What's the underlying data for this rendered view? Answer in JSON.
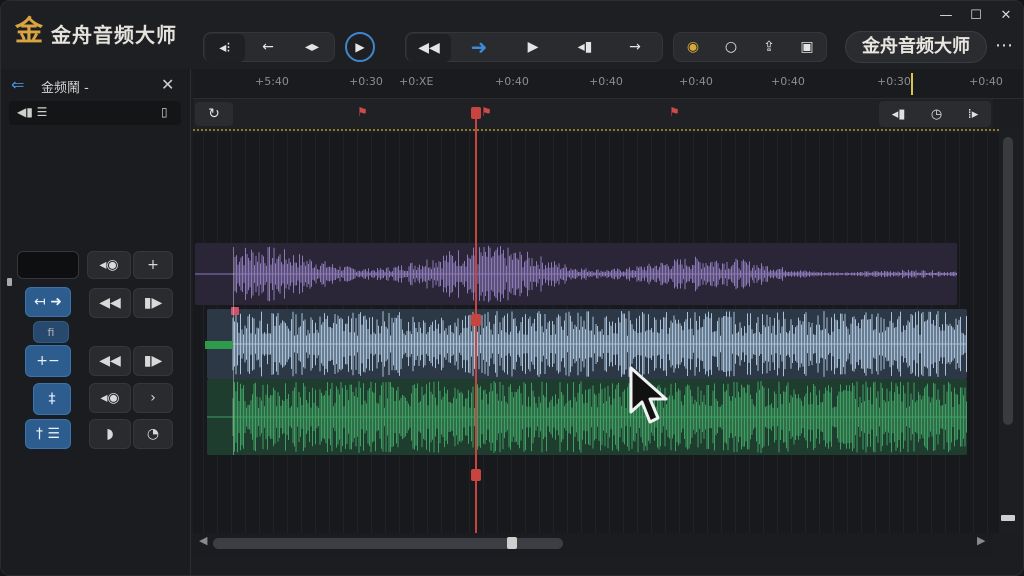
{
  "app": {
    "logo_char": "金",
    "title": "金舟音频大师",
    "title_pill": "金舟音频大师",
    "window_controls": {
      "minimize": "—",
      "maximize": "☐",
      "close": "✕"
    },
    "more": "⋯"
  },
  "toolbar": {
    "group1": [
      "◂⁝",
      "←",
      "◂▸"
    ],
    "play": "▶",
    "group2": [
      "◀◀",
      "➜",
      "▶",
      "◂▮",
      "→"
    ],
    "group3": [
      "◉",
      "○",
      "⇪",
      "▣"
    ]
  },
  "panel": {
    "back_icon": "⇐",
    "title": "金频鬧 -",
    "close": "✕",
    "mini_left": "◀▮ ☰",
    "mini_right": "▯",
    "controls": [
      [
        "",
        "◂◉",
        "+"
      ],
      [
        "↤ ➜",
        "◀◀",
        "▮▶"
      ],
      [
        "fi"
      ],
      [
        "+−",
        "◀◀",
        "▮▶"
      ],
      [
        "‡",
        "◂◉",
        "›"
      ],
      [
        "† ☰",
        "◗",
        "◔"
      ]
    ]
  },
  "ruler": {
    "ticks": [
      "+5:40",
      "+0:30",
      "+0:XE",
      "+0:40",
      "+0:40",
      "+0:40",
      "+0:40",
      "+0:30",
      "+0:40"
    ]
  },
  "marker_bar": {
    "loop": "↻",
    "tools": [
      "◂▮",
      "◷",
      "⁞▸"
    ]
  },
  "tracks": [
    {
      "name": "purple-track",
      "color": "#8c79b8",
      "bg": "#2a2638"
    },
    {
      "name": "blue-track",
      "color": "#a8c0d8",
      "bg": "#2d3a48"
    },
    {
      "name": "green-track",
      "color": "#3f9e62",
      "bg": "#204232"
    }
  ]
}
